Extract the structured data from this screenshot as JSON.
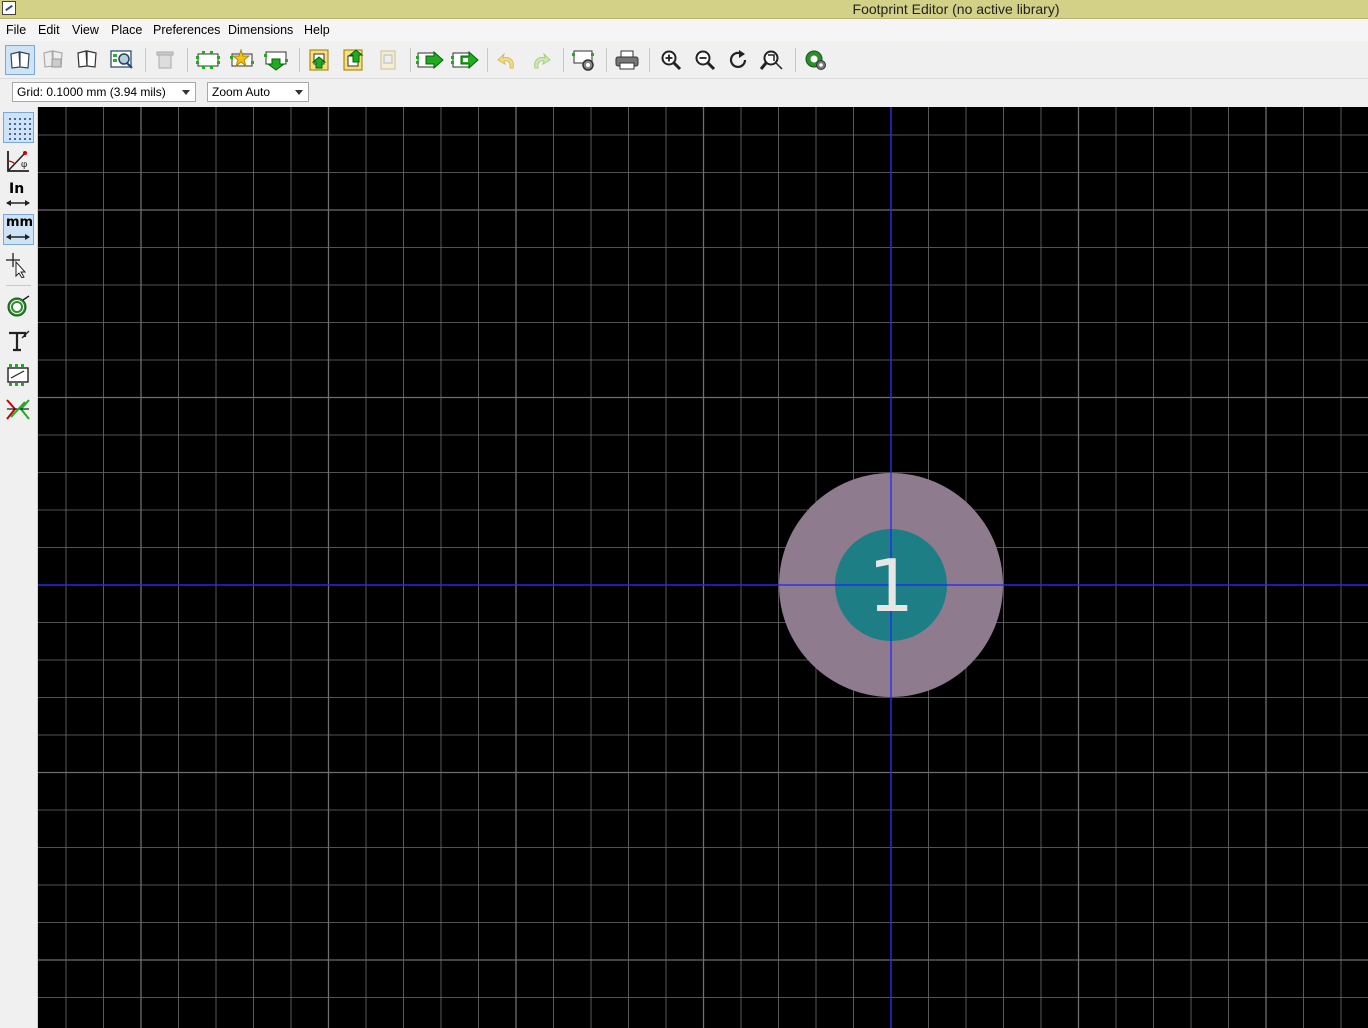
{
  "window": {
    "title": "Footprint Editor (no active library)",
    "app_icon": "kicad-app-icon"
  },
  "menu": {
    "items": [
      "File",
      "Edit",
      "View",
      "Place",
      "Preferences",
      "Dimensions",
      "Help"
    ]
  },
  "toolbar": {
    "buttons": [
      "select-library-icon",
      "save-library-icon",
      "new-library-icon",
      "library-browser-icon",
      "delete-icon",
      "new-footprint-icon",
      "footprint-wizard-icon",
      "load-from-board-icon",
      "import-footprint-icon",
      "export-footprint-icon",
      "insert-board-icon",
      "load-into-board-icon",
      "update-board-icon",
      "undo-icon",
      "redo-icon",
      "footprint-properties-icon",
      "print-icon",
      "zoom-in-icon",
      "zoom-out-icon",
      "redraw-icon",
      "zoom-fit-icon",
      "pad-settings-icon"
    ]
  },
  "toolbar2": {
    "grid_value": "Grid: 0.1000 mm (3.94 mils)",
    "zoom_value": "Zoom Auto"
  },
  "left_toolbar": {
    "units_inch_label": "In",
    "units_mm_label": "mm",
    "buttons": [
      "grid-toggle-icon",
      "polar-coords-icon",
      "units-inch-icon",
      "units-mm-icon",
      "cursor-shape-icon",
      "pad-sketch-icon",
      "text-sketch-icon",
      "footprint-sketch-icon",
      "high-contrast-icon"
    ]
  },
  "canvas": {
    "background": "#000000",
    "grid_color": "#6e6e6e",
    "axis_color": "#2020ff",
    "pad": {
      "number": "1",
      "copper_color": "#8e7b8e",
      "hole_color": "#1e7e86",
      "label_color": "#e6e6e6"
    }
  }
}
